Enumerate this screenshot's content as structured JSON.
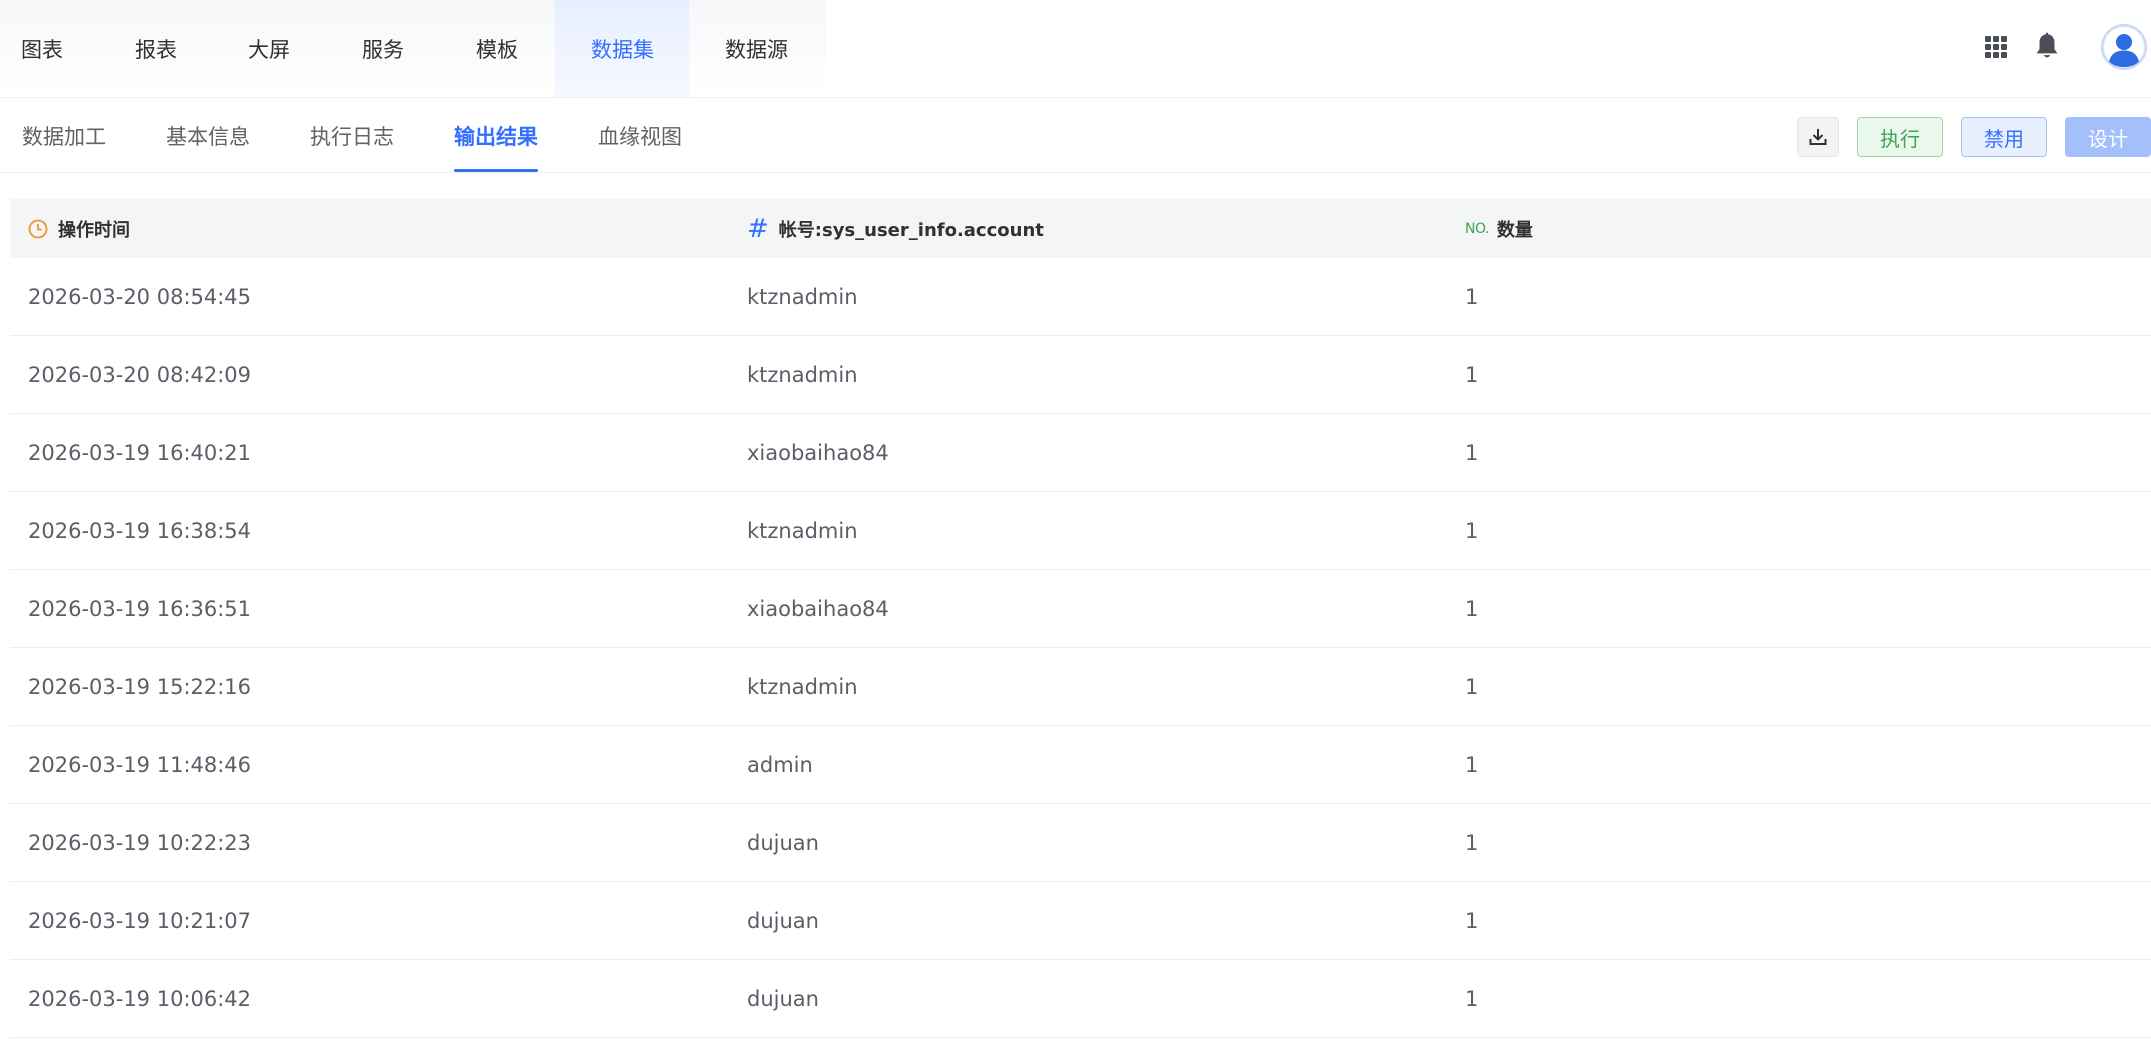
{
  "top_nav": {
    "items": [
      {
        "label": "图表"
      },
      {
        "label": "报表"
      },
      {
        "label": "大屏"
      },
      {
        "label": "服务"
      },
      {
        "label": "模板"
      },
      {
        "label": "数据集",
        "active": true
      },
      {
        "label": "数据源"
      }
    ],
    "icons": [
      "apps-grid-icon",
      "bell-icon",
      "user-avatar-icon"
    ]
  },
  "sub_tabs": {
    "items": [
      {
        "label": "数据加工"
      },
      {
        "label": "基本信息"
      },
      {
        "label": "执行日志"
      },
      {
        "label": "输出结果",
        "active": true
      },
      {
        "label": "血缘视图"
      }
    ]
  },
  "actions": {
    "download_icon": "download-icon",
    "run_label": "执行",
    "disable_label": "禁用",
    "design_label": "设计"
  },
  "table": {
    "columns": [
      {
        "label": "操作时间",
        "icon": "clock-icon"
      },
      {
        "label": "帐号:sys_user_info.account",
        "icon": "hash-icon"
      },
      {
        "label": "数量",
        "icon": "number-icon",
        "tag": "NO."
      }
    ],
    "rows": [
      [
        "2026-03-20 08:54:45",
        "ktznadmin",
        "1"
      ],
      [
        "2026-03-20 08:42:09",
        "ktznadmin",
        "1"
      ],
      [
        "2026-03-19 16:40:21",
        "xiaobaihao84",
        "1"
      ],
      [
        "2026-03-19 16:38:54",
        "ktznadmin",
        "1"
      ],
      [
        "2026-03-19 16:36:51",
        "xiaobaihao84",
        "1"
      ],
      [
        "2026-03-19 15:22:16",
        "ktznadmin",
        "1"
      ],
      [
        "2026-03-19 11:48:46",
        "admin",
        "1"
      ],
      [
        "2026-03-19 10:22:23",
        "dujuan",
        "1"
      ],
      [
        "2026-03-19 10:21:07",
        "dujuan",
        "1"
      ],
      [
        "2026-03-19 10:06:42",
        "dujuan",
        "1"
      ]
    ]
  },
  "colors": {
    "accent": "#3370ff",
    "success": "#3ba54f",
    "clock": "#f0932b"
  }
}
